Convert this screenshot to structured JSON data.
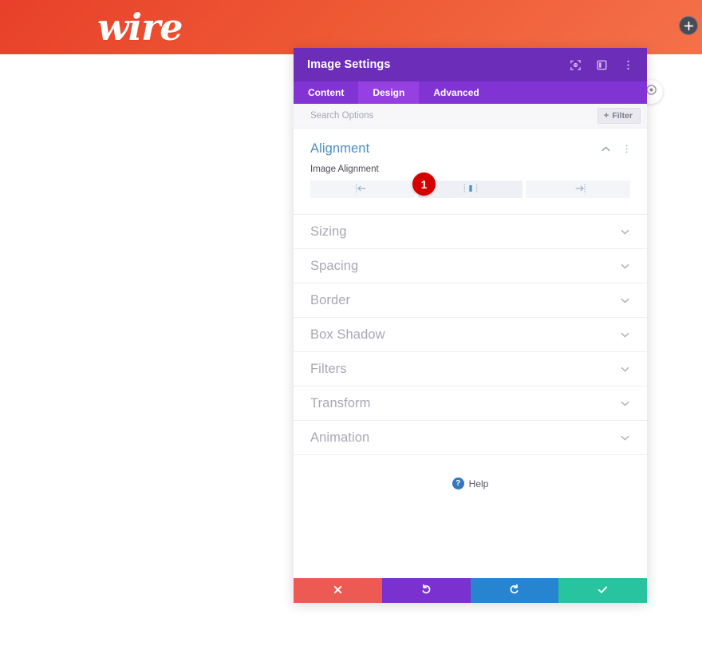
{
  "site": {
    "logo_text": "wire",
    "header_gradient_from": "#e8402a",
    "header_gradient_to": "#f4714a",
    "add_button_icon": "plus-circle-icon"
  },
  "floating_button": {
    "icon": "settings-circle-icon"
  },
  "modal": {
    "title": "Image Settings",
    "titlebar_color": "#6c2eb9",
    "titlebar_icons": [
      {
        "name": "focus-target-icon",
        "label": "Focus Mode"
      },
      {
        "name": "panel-layout-icon",
        "label": "Change Panel Position"
      },
      {
        "name": "more-vertical-icon",
        "label": "More Options"
      }
    ],
    "tabs": [
      {
        "label": "Content",
        "active": false
      },
      {
        "label": "Design",
        "active": true
      },
      {
        "label": "Advanced",
        "active": false
      }
    ],
    "search": {
      "placeholder": "Search Options",
      "value": ""
    },
    "filter_button": {
      "label": "Filter",
      "plus": "+",
      "icon": "plus-icon"
    },
    "open_section": {
      "title": "Alignment",
      "title_color": "#4a8fc4",
      "collapse_icon": "chevron-up-icon",
      "menu_icon": "more-vertical-icon",
      "field": {
        "label": "Image Alignment",
        "options": [
          {
            "name": "align-left",
            "icon": "align-left-icon",
            "active": false
          },
          {
            "name": "align-center",
            "icon": "align-center-icon",
            "active": true
          },
          {
            "name": "align-right",
            "icon": "align-right-icon",
            "active": false
          }
        ],
        "badge": "1",
        "badge_color": "#d40000"
      }
    },
    "collapsed_sections": [
      {
        "label": "Sizing",
        "icon": "chevron-down-icon"
      },
      {
        "label": "Spacing",
        "icon": "chevron-down-icon"
      },
      {
        "label": "Border",
        "icon": "chevron-down-icon"
      },
      {
        "label": "Box Shadow",
        "icon": "chevron-down-icon"
      },
      {
        "label": "Filters",
        "icon": "chevron-down-icon"
      },
      {
        "label": "Transform",
        "icon": "chevron-down-icon"
      },
      {
        "label": "Animation",
        "icon": "chevron-down-icon"
      }
    ],
    "help": {
      "label": "Help",
      "icon": "question-mark-icon",
      "icon_color": "#3478bd"
    },
    "footer_actions": [
      {
        "name": "cancel-button",
        "icon": "close-x-icon",
        "color": "#ec5a53",
        "label": "Cancel"
      },
      {
        "name": "undo-button",
        "icon": "undo-arrow-icon",
        "color": "#7a31cf",
        "label": "Undo"
      },
      {
        "name": "redo-button",
        "icon": "redo-arrow-icon",
        "color": "#2684d0",
        "label": "Redo"
      },
      {
        "name": "save-button",
        "icon": "checkmark-icon",
        "color": "#28c4a0",
        "label": "Save"
      }
    ]
  }
}
